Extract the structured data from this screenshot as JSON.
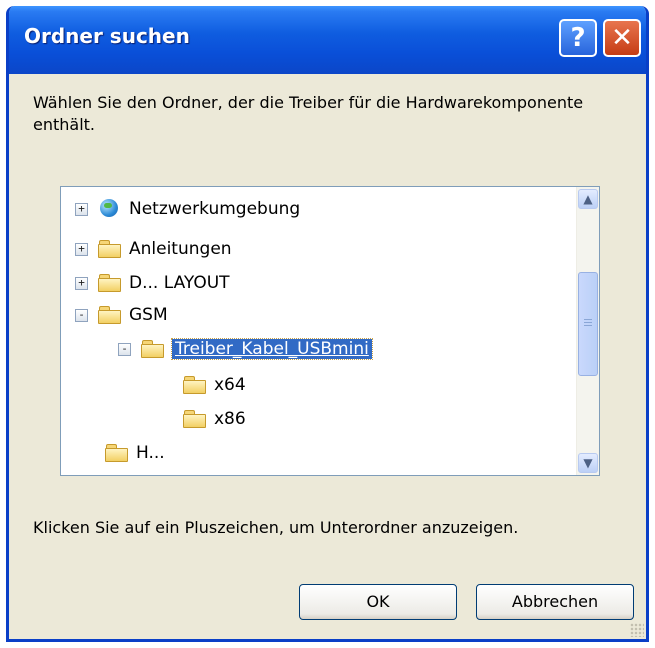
{
  "window": {
    "title": "Ordner suchen"
  },
  "titlebar": {
    "help_glyph": "?",
    "close_glyph": "✕"
  },
  "intro_text": "Wählen Sie den Ordner, der die Treiber für die Hardwarekomponente enthält.",
  "tree": {
    "items": [
      {
        "label": "Netzwerkumgebung",
        "icon": "network-globe-icon",
        "expander": "+"
      },
      {
        "label": "Anleitungen",
        "icon": "folder-icon",
        "expander": "+"
      },
      {
        "label": "D... LAYOUT",
        "icon": "folder-icon",
        "expander": "+"
      },
      {
        "label": "GSM",
        "icon": "folder-icon",
        "expander": "-"
      },
      {
        "label": "Treiber_Kabel_USBmini",
        "icon": "open-folder-icon",
        "expander": "-",
        "selected": true
      },
      {
        "label": "x64",
        "icon": "folder-icon"
      },
      {
        "label": "x86",
        "icon": "folder-icon"
      },
      {
        "label": "H...",
        "icon": "folder-icon"
      }
    ],
    "scroll_up_glyph": "▲",
    "scroll_down_glyph": "▼"
  },
  "hint_text": "Klicken Sie auf ein Pluszeichen, um Unterordner anzuzeigen.",
  "buttons": {
    "ok": "OK",
    "cancel": "Abbrechen"
  }
}
